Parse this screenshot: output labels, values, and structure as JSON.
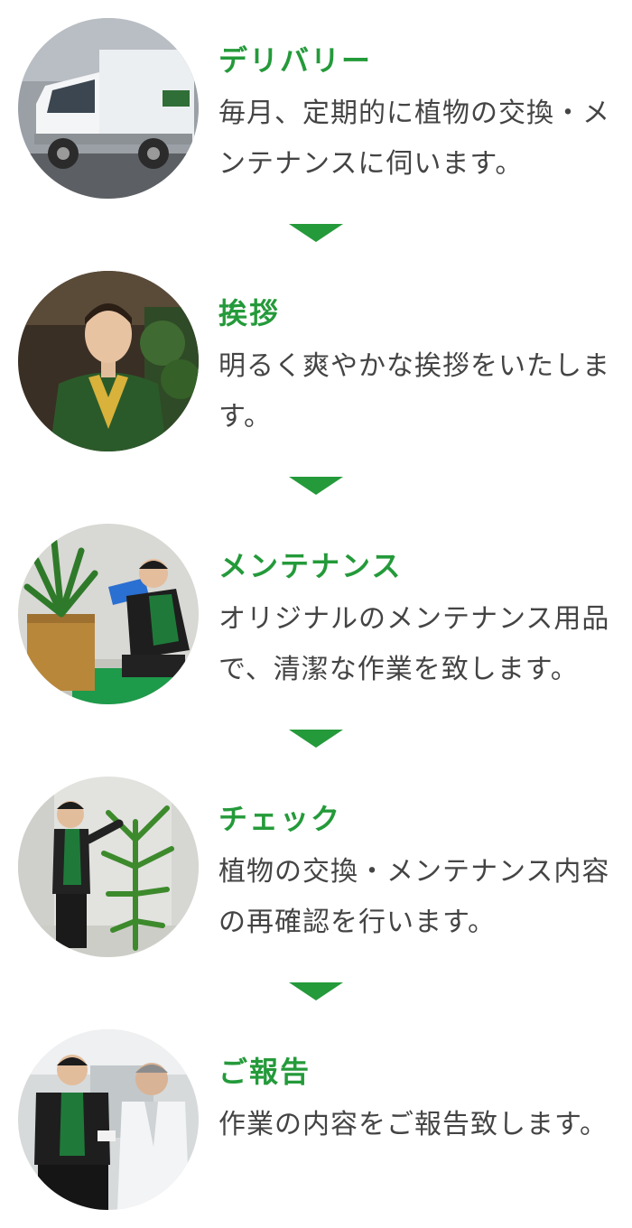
{
  "steps": [
    {
      "title": "デリバリー",
      "description": "毎月、定期的に植物の交換・メンテナンスに伺います。",
      "photo": "delivery-truck-photo"
    },
    {
      "title": "挨拶",
      "description": "明るく爽やかな挨拶をいたします。",
      "photo": "staff-greeting-photo"
    },
    {
      "title": "メンテナンス",
      "description": "オリジナルのメンテナンス用品で、清潔な作業を致します。",
      "photo": "plant-watering-photo"
    },
    {
      "title": "チェック",
      "description": "植物の交換・メンテナンス内容の再確認を行います。",
      "photo": "plant-check-photo"
    },
    {
      "title": "ご報告",
      "description": "作業の内容をご報告致します。",
      "photo": "report-to-client-photo"
    }
  ],
  "colors": {
    "accent": "#249a3a",
    "text": "#444444",
    "background": "#ffffff"
  },
  "icons": {
    "arrow": "triangle-down-icon"
  }
}
